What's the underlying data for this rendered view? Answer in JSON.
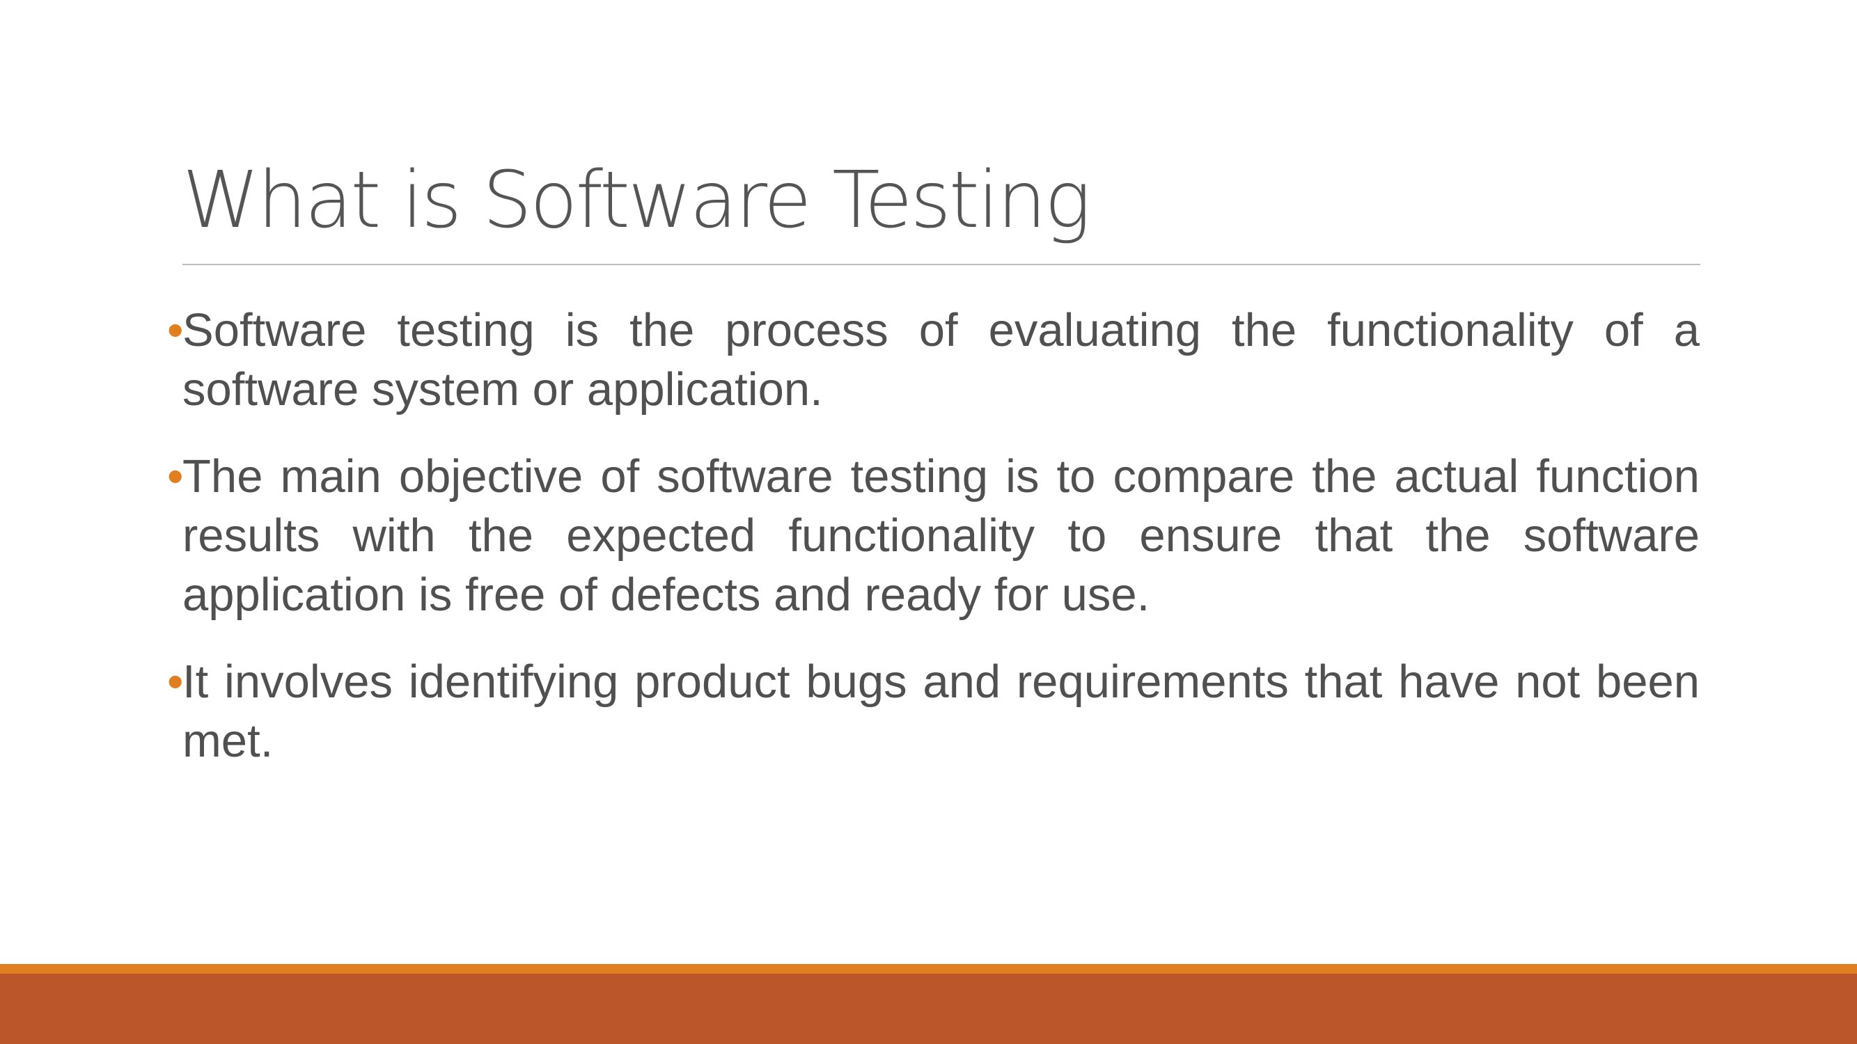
{
  "slide": {
    "title": "What is Software Testing",
    "bullet_symbol": "•",
    "bullets": [
      "Software testing is the process of evaluating the functionality of a software system or application.",
      "The main objective of software testing is to compare the actual function results with the expected functionality to ensure that the software application is free of defects and ready for use.",
      "It involves identifying product bugs and requirements that have not been met."
    ]
  },
  "colors": {
    "text": "#505050",
    "title": "#555555",
    "accent_orange": "#e07f1f",
    "footer_rust": "#bb562b",
    "rule": "#bdbdbd"
  }
}
